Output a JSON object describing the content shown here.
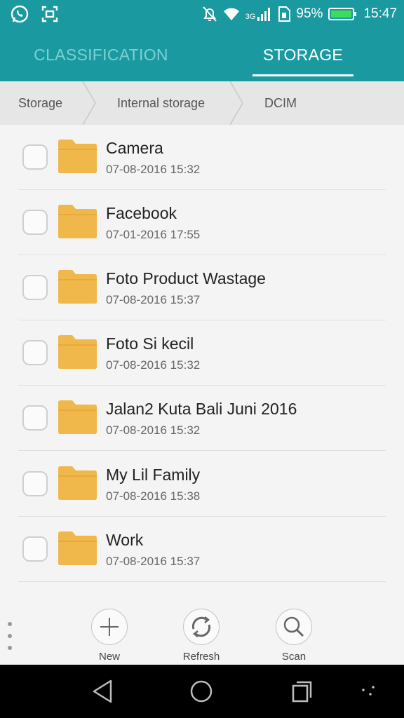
{
  "status_bar": {
    "battery_percent": "95%",
    "time": "15:47",
    "network_type": "3G",
    "icons": [
      "whatsapp-icon",
      "screenshot-icon",
      "notifications-off-icon",
      "wifi-icon",
      "signal-icon",
      "sim-icon",
      "battery-icon"
    ]
  },
  "tabs": [
    {
      "label": "CLASSIFICATION",
      "active": false
    },
    {
      "label": "STORAGE",
      "active": true
    }
  ],
  "breadcrumb": [
    "Storage",
    "Internal storage",
    "DCIM"
  ],
  "files": [
    {
      "name": "Camera",
      "date": "07-08-2016 15:32"
    },
    {
      "name": "Facebook",
      "date": "07-01-2016 17:55"
    },
    {
      "name": "Foto Product Wastage",
      "date": "07-08-2016 15:37"
    },
    {
      "name": "Foto Si kecil",
      "date": "07-08-2016 15:32"
    },
    {
      "name": "Jalan2 Kuta Bali Juni 2016",
      "date": "07-08-2016 15:32"
    },
    {
      "name": "My Lil Family",
      "date": "07-08-2016 15:38"
    },
    {
      "name": "Work",
      "date": "07-08-2016 15:37"
    }
  ],
  "toolbar": {
    "new_label": "New",
    "refresh_label": "Refresh",
    "scan_label": "Scan"
  },
  "colors": {
    "accent": "#1a9aa0",
    "folder": "#f0b84b",
    "inactive_tab": "#7cd0d4"
  }
}
